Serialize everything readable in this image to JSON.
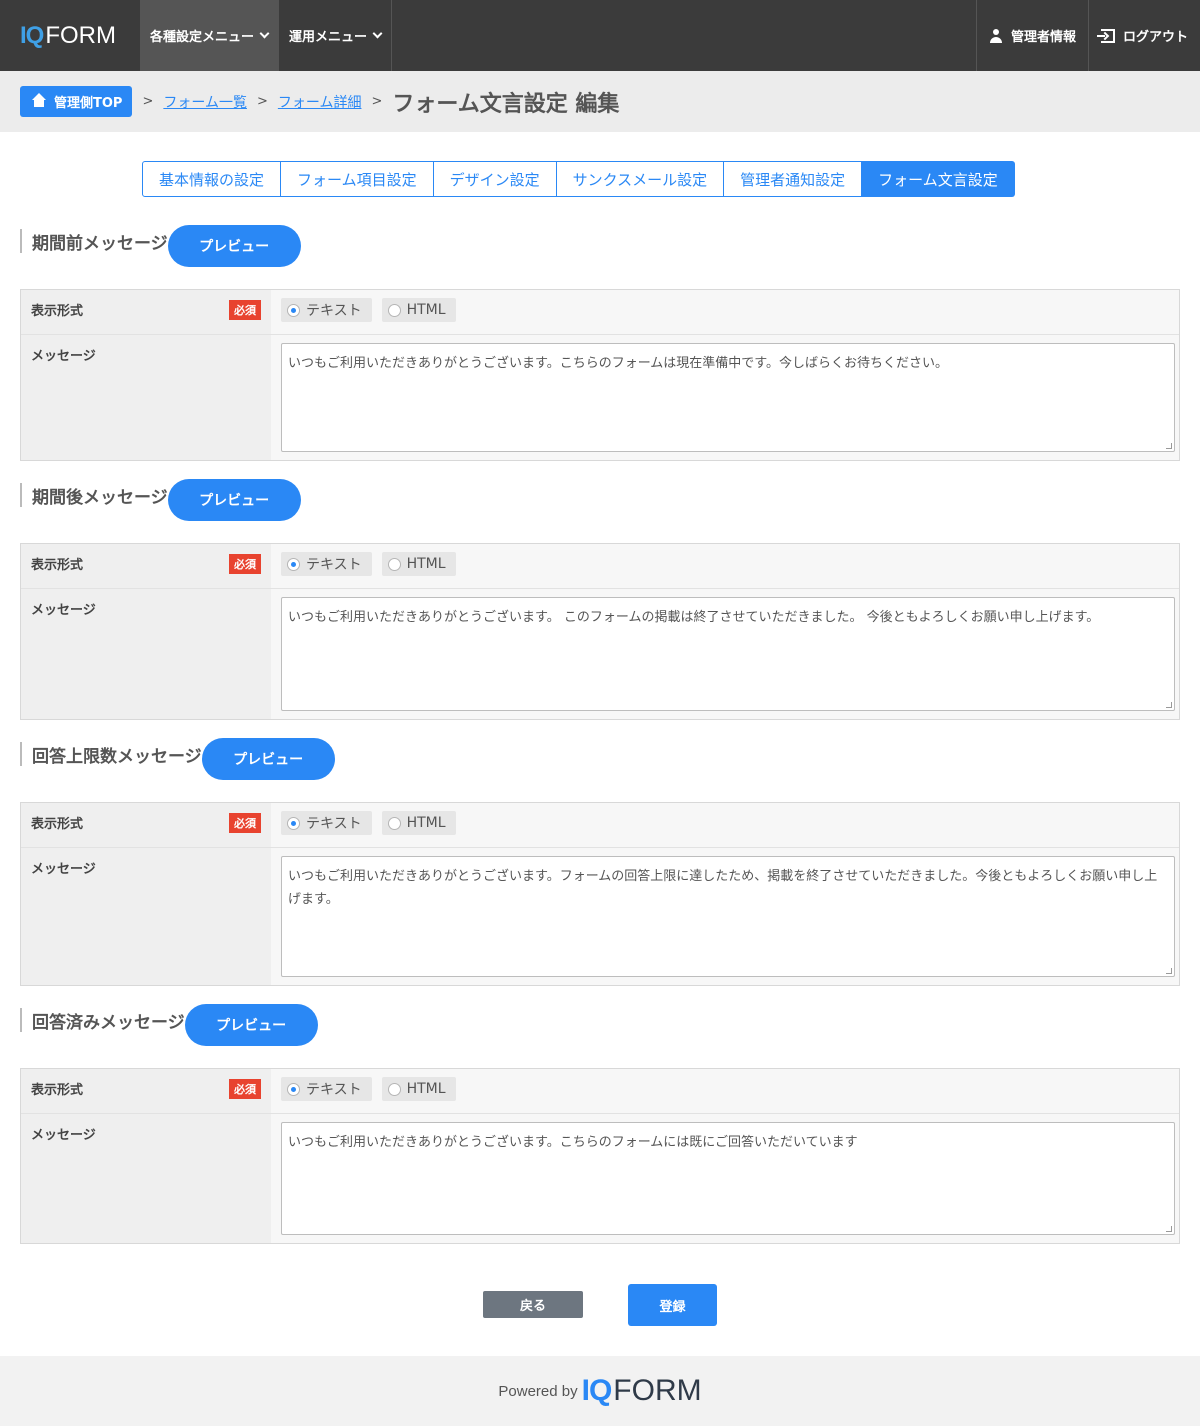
{
  "header": {
    "logo_iq": "IQ",
    "logo_form": "FORM",
    "nav": [
      {
        "label": "各種設定メニュー"
      },
      {
        "label": "運用メニュー"
      }
    ],
    "admin_info": "管理者情報",
    "logout": "ログアウト"
  },
  "breadcrumb": {
    "home": "管理側TOP",
    "sep": ">",
    "links": [
      "フォーム一覧",
      "フォーム詳細"
    ],
    "current": "フォーム文言設定 編集"
  },
  "tabs": [
    {
      "label": "基本情報の設定"
    },
    {
      "label": "フォーム項目設定"
    },
    {
      "label": "デザイン設定"
    },
    {
      "label": "サンクスメール設定"
    },
    {
      "label": "管理者通知設定"
    },
    {
      "label": "フォーム文言設定",
      "active": true
    }
  ],
  "labels": {
    "format": "表示形式",
    "required": "必須",
    "message": "メッセージ",
    "opt_text": "テキスト",
    "opt_html": "HTML",
    "preview": "プレビュー"
  },
  "sections": [
    {
      "title": "期間前メッセージ",
      "format": "テキスト",
      "message": "いつもご利用いただきありがとうございます。こちらのフォームは現在準備中です。今しばらくお待ちください。"
    },
    {
      "title": "期間後メッセージ",
      "format": "テキスト",
      "message": "いつもご利用いただきありがとうございます。 このフォームの掲載は終了させていただきました。 今後ともよろしくお願い申し上げます。"
    },
    {
      "title": "回答上限数メッセージ",
      "format": "テキスト",
      "message": "いつもご利用いただきありがとうございます。フォームの回答上限に達したため、掲載を終了させていただきました。今後ともよろしくお願い申し上げます。"
    },
    {
      "title": "回答済みメッセージ",
      "format": "テキスト",
      "message": "いつもご利用いただきありがとうございます。こちらのフォームには既にご回答いただいています"
    }
  ],
  "buttons": {
    "back": "戻る",
    "submit": "登録"
  },
  "footer": {
    "powered_by": "Powered by",
    "logo_iq": "IQ",
    "logo_form": "FORM"
  },
  "colors": {
    "accent": "#2a88f5",
    "header_bg": "#3b3b3b",
    "required_badge": "#e8432f",
    "back_button": "#6d7680"
  }
}
